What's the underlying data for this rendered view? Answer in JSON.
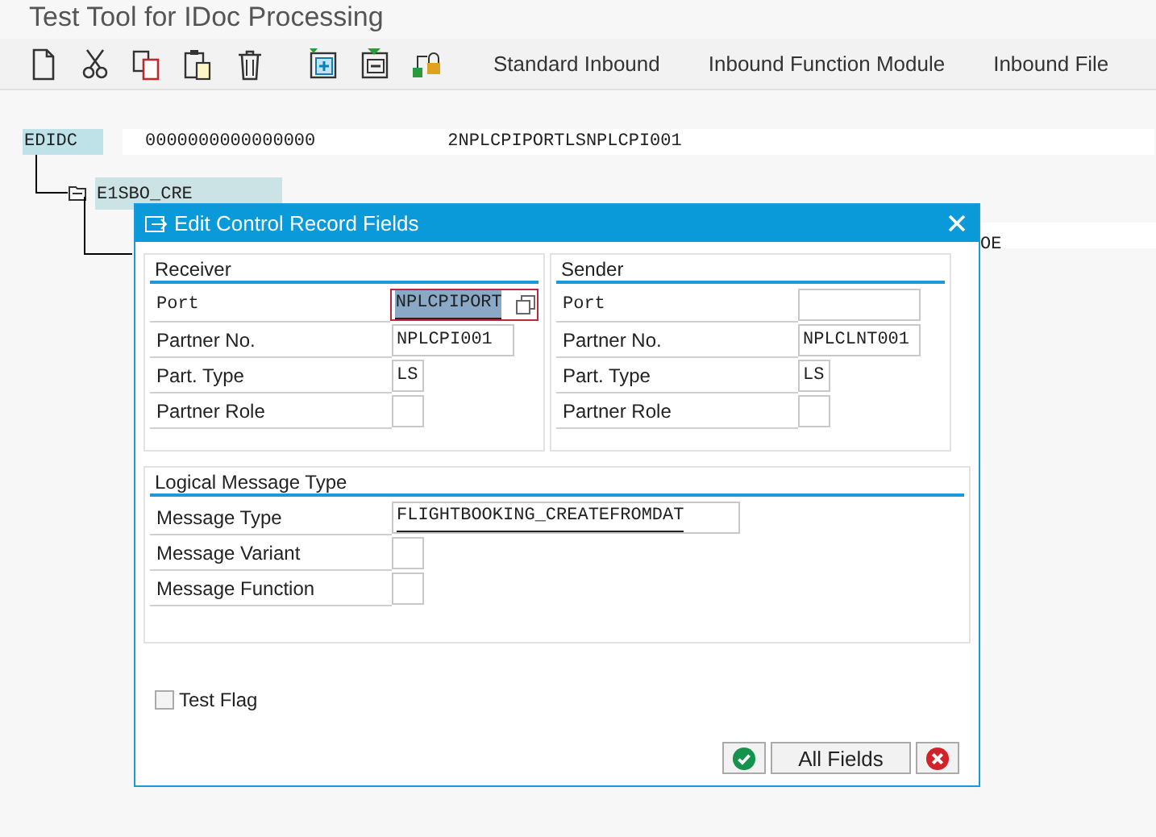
{
  "window": {
    "title": "Test Tool for IDoc Processing"
  },
  "toolbar": {
    "buttons": [
      "Standard Inbound",
      "Inbound Function Module",
      "Inbound File"
    ]
  },
  "tree": {
    "root": {
      "label": "EDIDC",
      "cells": [
        "0000000000000000",
        "2NPLCPIPORTLSNPLCPI001"
      ],
      "children": [
        {
          "label": "E1SBO_CRE",
          "children": [
            {
              "cells": [
                "OE"
              ]
            }
          ]
        }
      ]
    }
  },
  "dialog": {
    "title": "Edit Control Record Fields",
    "groups": [
      {
        "title": "Receiver",
        "rows": [
          {
            "label": "Port",
            "value": "NPLCPIPORT",
            "kind": "medium",
            "mono_label": true,
            "selected": true,
            "value_help": true
          },
          {
            "label": "Partner No.",
            "value": "NPLCPI001",
            "kind": "medium",
            "mono_label": false,
            "selected": false,
            "value_help": false
          },
          {
            "label": "Part. Type",
            "value": "LS",
            "kind": "short",
            "mono_label": false,
            "selected": false,
            "value_help": false
          },
          {
            "label": "Partner Role",
            "value": "",
            "kind": "short",
            "mono_label": false,
            "selected": false,
            "value_help": false
          }
        ]
      },
      {
        "title": "Sender",
        "rows": [
          {
            "label": "Port",
            "value": "",
            "kind": "medium",
            "mono_label": true,
            "selected": false,
            "value_help": false
          },
          {
            "label": "Partner No.",
            "value": "NPLCLNT001",
            "kind": "medium",
            "mono_label": false,
            "selected": false,
            "value_help": false
          },
          {
            "label": "Part. Type",
            "value": "LS",
            "kind": "short",
            "mono_label": false,
            "selected": false,
            "value_help": false
          },
          {
            "label": "Partner Role",
            "value": "",
            "kind": "short",
            "mono_label": false,
            "selected": false,
            "value_help": false
          }
        ]
      }
    ],
    "logical": {
      "title": "Logical Message Type",
      "rows": [
        {
          "label": "Message Type",
          "value": "FLIGHTBOOKING_CREATEFROMDAT",
          "kind": "long",
          "mono_label": false,
          "selected": false,
          "value_help": false
        },
        {
          "label": "Message Variant",
          "value": "",
          "kind": "short",
          "mono_label": false,
          "selected": false,
          "value_help": false
        },
        {
          "label": "Message Function",
          "value": "",
          "kind": "short",
          "mono_label": false,
          "selected": false,
          "value_help": false
        }
      ]
    },
    "test_flag": {
      "label": "Test Flag",
      "checked": false
    },
    "buttons": {
      "all_fields": "All Fields"
    }
  }
}
